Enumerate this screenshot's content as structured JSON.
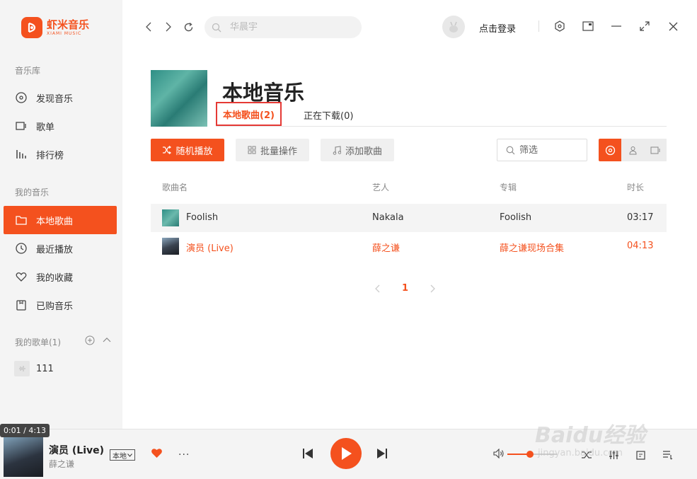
{
  "brand": {
    "name_cn": "虾米音乐",
    "name_en": "XIAMI MUSIC",
    "accent": "#f4511e"
  },
  "sidebar": {
    "library_title": "音乐库",
    "library_items": [
      {
        "label": "发现音乐",
        "icon": "disc-icon"
      },
      {
        "label": "歌单",
        "icon": "playlist-icon"
      },
      {
        "label": "排行榜",
        "icon": "chart-icon"
      }
    ],
    "my_music_title": "我的音乐",
    "my_music_items": [
      {
        "label": "本地歌曲",
        "icon": "folder-icon",
        "active": true
      },
      {
        "label": "最近播放",
        "icon": "clock-icon"
      },
      {
        "label": "我的收藏",
        "icon": "heart-icon"
      },
      {
        "label": "已购音乐",
        "icon": "purchased-icon"
      }
    ],
    "playlists_title": "我的歌单(1)",
    "playlists": [
      {
        "label": "111"
      }
    ]
  },
  "topbar": {
    "search_placeholder": "华晨宇",
    "login_label": "点击登录"
  },
  "header": {
    "title": "本地音乐",
    "tabs": [
      {
        "label": "本地歌曲(2)",
        "active": true
      },
      {
        "label": "正在下载(0)"
      }
    ]
  },
  "toolbar": {
    "shuffle_label": "随机播放",
    "batch_label": "批量操作",
    "add_label": "添加歌曲",
    "filter_placeholder": "筛选"
  },
  "table": {
    "columns": [
      "歌曲名",
      "艺人",
      "专辑",
      "时长"
    ],
    "rows": [
      {
        "title": "Foolish",
        "artist": "Nakala",
        "album": "Foolish",
        "duration": "03:17",
        "playing": false
      },
      {
        "title": "演员 (Live)",
        "artist": "薛之谦",
        "album": "薛之谦现场合集",
        "duration": "04:13",
        "playing": true
      }
    ]
  },
  "pager": {
    "current": "1"
  },
  "player": {
    "time": "0:01 / 4:13",
    "title": "演员 (Live)",
    "artist": "薛之谦",
    "source": "本地",
    "volume": 0.45
  },
  "watermark": {
    "main": "Baidu经验",
    "sub": "jingyan.baidu.com"
  }
}
